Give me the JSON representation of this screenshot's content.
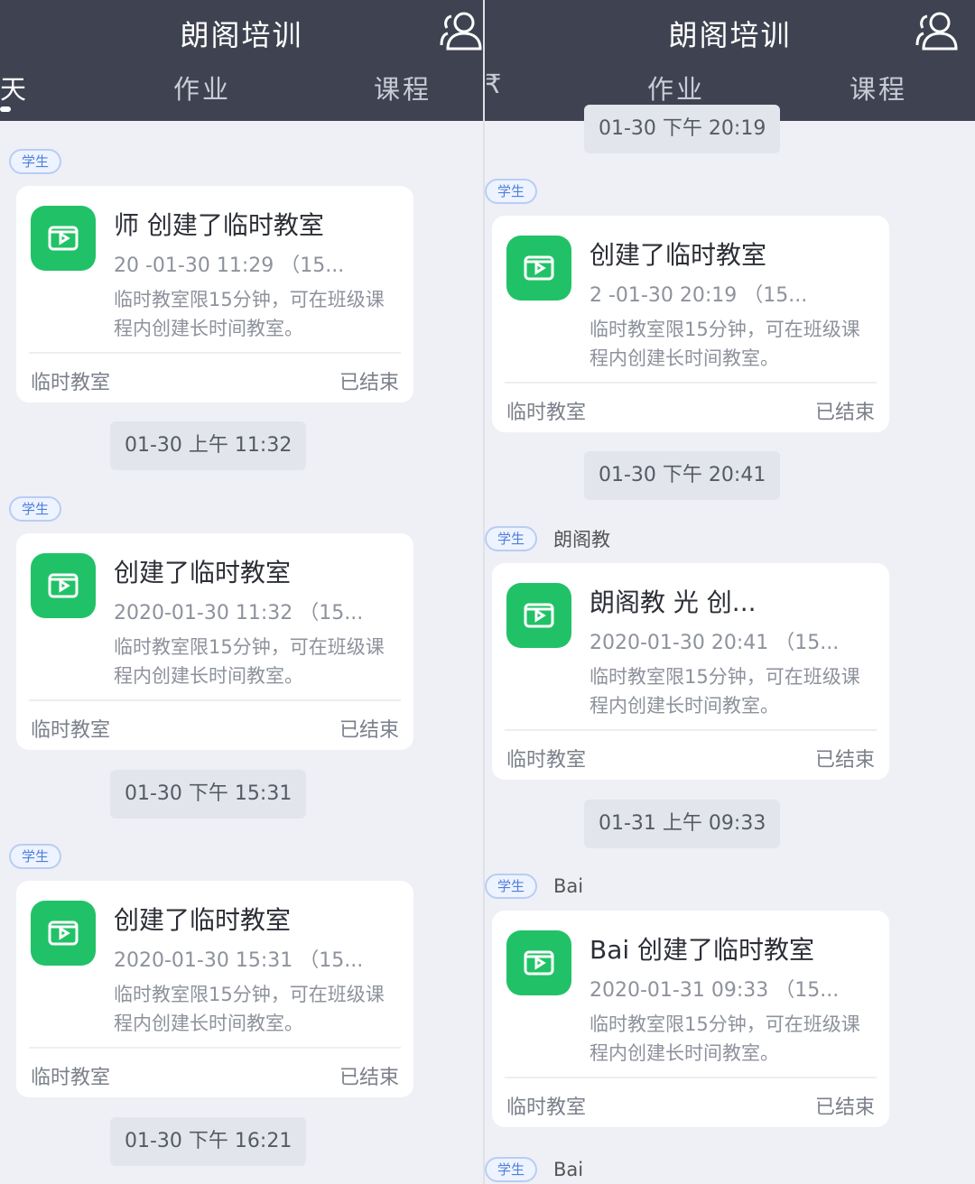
{
  "app": {
    "title": "朗阁培训",
    "tabs": {
      "partial": "天",
      "partial_right": "₹",
      "homework": "作业",
      "course": "课程"
    },
    "icon": "group-icon"
  },
  "colors": {
    "header": "#3f4351",
    "accent_green": "#21c267",
    "badge_blue": "#4f7fd9",
    "background": "#eef0f5"
  },
  "badge_label": "学生",
  "left_feed": {
    "timestamps": [
      "01-30 上午 11:32",
      "01-30 下午 15:31",
      "01-30 下午 16:21"
    ],
    "senders": [
      "",
      "",
      ""
    ],
    "cards": [
      {
        "title": "师 创建了临时教室",
        "time": "20 -01-30 11:29  （15...",
        "desc": "临时教室限15分钟，可在班级课程内创建长时间教室。",
        "footer_left": "临时教室",
        "footer_right": "已结束"
      },
      {
        "title": "创建了临时教室",
        "time": "2020-01-30 11:32  （15...",
        "desc": "临时教室限15分钟，可在班级课程内创建长时间教室。",
        "footer_left": "临时教室",
        "footer_right": "已结束"
      },
      {
        "title": "创建了临时教室",
        "time": "2020-01-30 15:31  （15...",
        "desc": "临时教室限15分钟，可在班级课程内创建长时间教室。",
        "footer_left": "临时教室",
        "footer_right": "已结束"
      }
    ]
  },
  "right_feed": {
    "timestamps": [
      "01-30 下午 20:19",
      "01-30 下午 20:41",
      "01-31 上午 09:33"
    ],
    "senders": [
      "",
      "朗阁教",
      "Bai",
      "Bai"
    ],
    "cards": [
      {
        "title": "创建了临时教室",
        "time": "2  -01-30 20:19  （15...",
        "desc": "临时教室限15分钟，可在班级课程内创建长时间教室。",
        "footer_left": "临时教室",
        "footer_right": "已结束"
      },
      {
        "title": "朗阁教   光 创...",
        "time": "2020-01-30 20:41  （15...",
        "desc": "临时教室限15分钟，可在班级课程内创建长时间教室。",
        "footer_left": "临时教室",
        "footer_right": "已结束"
      },
      {
        "title": "Bai 创建了临时教室",
        "time": "2020-01-31 09:33  （15...",
        "desc": "临时教室限15分钟，可在班级课程内创建长时间教室。",
        "footer_left": "临时教室",
        "footer_right": "已结束"
      }
    ]
  }
}
